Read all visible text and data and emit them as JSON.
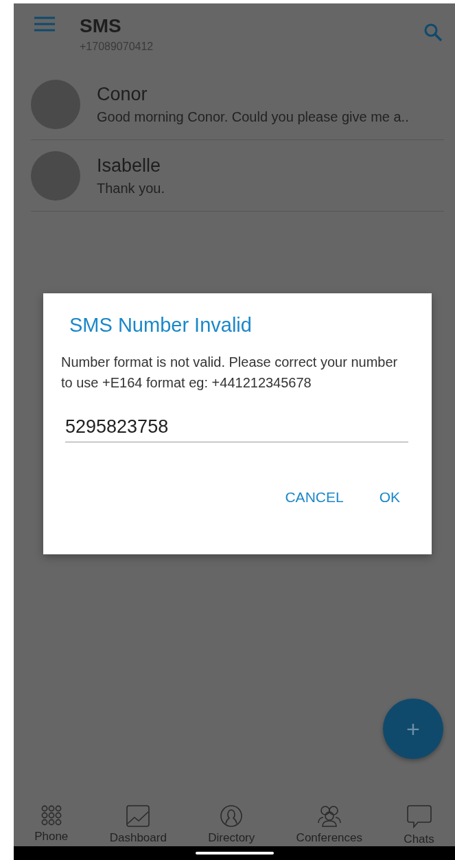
{
  "header": {
    "title": "SMS",
    "subtitle": "+17089070412"
  },
  "conversations": [
    {
      "name": "Conor",
      "preview": "Good morning Conor. Could you please give me a.."
    },
    {
      "name": "Isabelle",
      "preview": "Thank you."
    }
  ],
  "dialog": {
    "title": "SMS Number Invalid",
    "message": "Number format is not valid. Please correct your number to use +E164 format eg: +441212345678",
    "value": "5295823758",
    "buttons": [
      "CANCEL",
      "OK"
    ]
  },
  "fab": {
    "label": "+"
  },
  "bottom_nav": [
    {
      "label": "Phone",
      "kind": "dialpad"
    },
    {
      "label": "Dashboard",
      "kind": "chart"
    },
    {
      "label": "Directory",
      "kind": "person"
    },
    {
      "label": "Conferences",
      "kind": "group"
    },
    {
      "label": "Chats",
      "kind": "chat"
    }
  ]
}
